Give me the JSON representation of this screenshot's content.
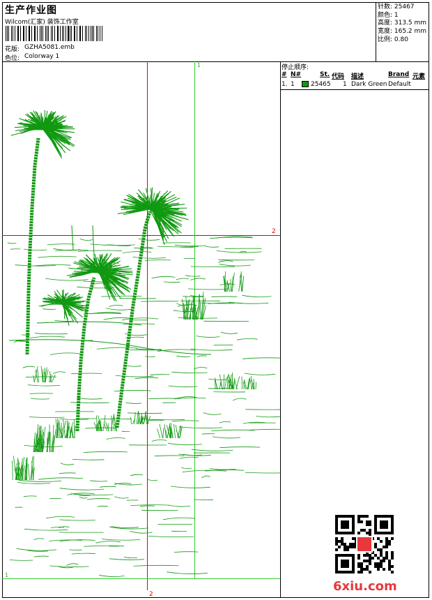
{
  "header": {
    "title": "生产作业图",
    "company": "Wilcom(汇家) 装饰工作室",
    "design_label": "花版:",
    "design_value": "GZHA5081.emb",
    "colorway_label": "色位:",
    "colorway_value": "Colorway 1"
  },
  "stats": {
    "stitches": "针数: 25467",
    "colors": "颜色: 1",
    "height": "高度: 313.5 mm",
    "width": "宽度: 165.2 mm",
    "scale": "比例: 0.80"
  },
  "stop_sequence": {
    "title": "停止顺序:",
    "headers": [
      "#",
      "N#",
      "St.",
      "代码",
      "描述",
      "Brand",
      "元素"
    ],
    "rows": [
      {
        "index": "1.",
        "needle": "1",
        "color": "#119911",
        "stitches": "25465",
        "code": "1",
        "description": "Dark Green",
        "brand": "Default",
        "element": ""
      }
    ]
  },
  "guides": {
    "red_h_label": "2",
    "red_v_label": "2",
    "green_top_label": "1",
    "green_left_label": "1"
  },
  "artwork": {
    "thread_color": "#119911",
    "guide_red": "#e00000",
    "guide_green": "#33cc33"
  },
  "watermark": {
    "text": "6xiu.com",
    "color": "#e8383d"
  }
}
